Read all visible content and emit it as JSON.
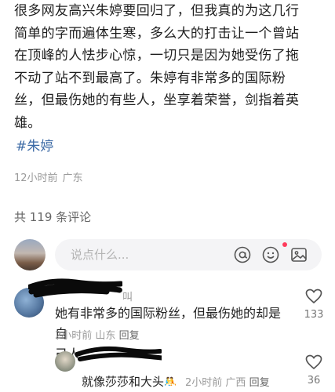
{
  "post": {
    "body": "很多网友高兴朱婷要回归了，但我真的为这几行\n简单的字而遍体生寒，多么大的打击让一个曾站\n在顶峰的人怯步心惊，一切只是因为她受伤了拖\n不动了站不到最高了。朱婷有非常多的国际粉\n丝，但最伤她的有些人，坐享着荣誉，剑指着英\n雄。",
    "hashtag": "#朱婷",
    "time": "12小时前",
    "location": "广东"
  },
  "comments_header": {
    "count_label": "共 119 条评论"
  },
  "composer": {
    "placeholder": "说点什么...",
    "icons": [
      "at-icon",
      "emoji-icon",
      "image-icon"
    ]
  },
  "comments": [
    {
      "name_fragment": "叫",
      "text": "她有非常多的国际粉丝，但最伤她的却是自\n己人",
      "time": "2小时前",
      "location": "山东",
      "reply_label": "回复",
      "likes": "133"
    },
    {
      "text": "就像莎莎和大头",
      "time": "2小时前",
      "location": "广西",
      "reply_label": "回复",
      "likes": "36"
    }
  ],
  "colors": {
    "hashtag": "#3d6ba6",
    "meta": "#9a9a9a",
    "notification_dot": "#ff3b5c"
  }
}
